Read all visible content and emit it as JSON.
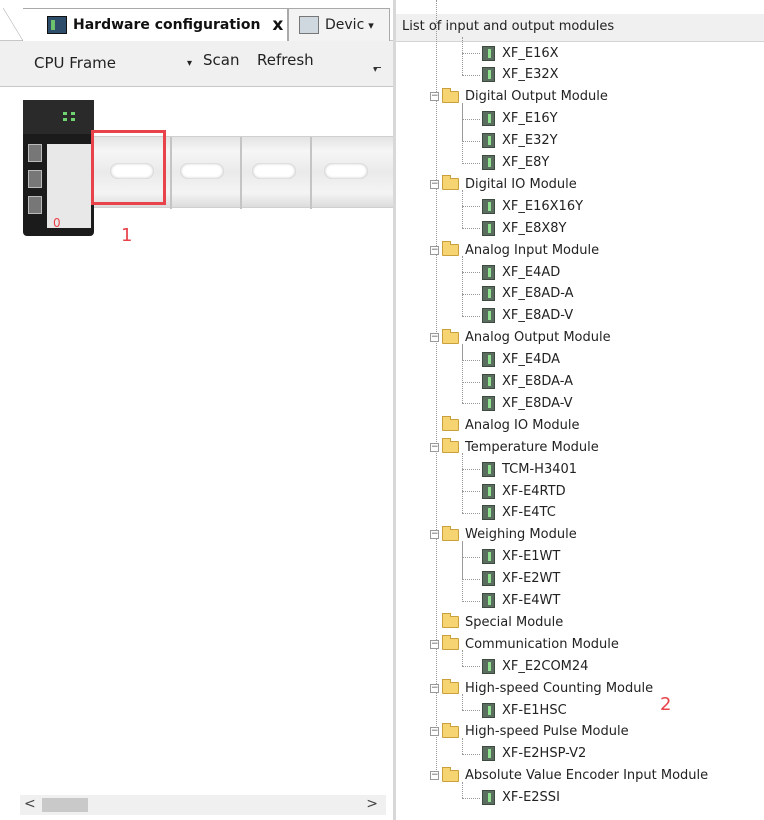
{
  "tabs": {
    "hardware": "Hardware configuration",
    "hardware_close": "x",
    "device": "Devic",
    "device_dropdown": "▾"
  },
  "toolbar": {
    "frame_select": "CPU Frame",
    "frame_arrow": "▾",
    "scan": "Scan",
    "refresh": "Refresh"
  },
  "canvas": {
    "cpu_index": "0",
    "slot_marker": "1"
  },
  "scrollbar": {
    "left": "<",
    "right": ">"
  },
  "right_panel": {
    "title": "List of input and output modules",
    "marker": "2"
  },
  "tree": [
    {
      "type": "module",
      "label": "XF_E16X"
    },
    {
      "type": "module",
      "label": "XF_E32X"
    },
    {
      "type": "folder",
      "label": "Digital Output Module",
      "expand": "−"
    },
    {
      "type": "module",
      "label": "XF_E16Y"
    },
    {
      "type": "module",
      "label": "XF_E32Y"
    },
    {
      "type": "module",
      "label": "XF_E8Y"
    },
    {
      "type": "folder",
      "label": "Digital IO Module",
      "expand": "−"
    },
    {
      "type": "module",
      "label": "XF_E16X16Y"
    },
    {
      "type": "module",
      "label": "XF_E8X8Y"
    },
    {
      "type": "folder",
      "label": "Analog Input Module",
      "expand": "−"
    },
    {
      "type": "module",
      "label": "XF_E4AD"
    },
    {
      "type": "module",
      "label": "XF_E8AD-A"
    },
    {
      "type": "module",
      "label": "XF_E8AD-V"
    },
    {
      "type": "folder",
      "label": "Analog Output Module",
      "expand": "−"
    },
    {
      "type": "module",
      "label": "XF_E4DA"
    },
    {
      "type": "module",
      "label": "XF_E8DA-A"
    },
    {
      "type": "module",
      "label": "XF_E8DA-V"
    },
    {
      "type": "folder",
      "label": "Analog IO Module",
      "expand": ""
    },
    {
      "type": "folder",
      "label": "Temperature Module",
      "expand": "−"
    },
    {
      "type": "module",
      "label": "TCM-H3401"
    },
    {
      "type": "module",
      "label": "XF-E4RTD"
    },
    {
      "type": "module",
      "label": "XF-E4TC"
    },
    {
      "type": "folder",
      "label": "Weighing Module",
      "expand": "−"
    },
    {
      "type": "module",
      "label": "XF-E1WT"
    },
    {
      "type": "module",
      "label": "XF-E2WT"
    },
    {
      "type": "module",
      "label": "XF-E4WT"
    },
    {
      "type": "folder",
      "label": "Special Module",
      "expand": ""
    },
    {
      "type": "folder",
      "label": "Communication Module",
      "expand": "−"
    },
    {
      "type": "module",
      "label": "XF_E2COM24"
    },
    {
      "type": "folder",
      "label": "High-speed Counting Module",
      "expand": "−"
    },
    {
      "type": "module",
      "label": "XF-E1HSC"
    },
    {
      "type": "folder",
      "label": "High-speed Pulse Module",
      "expand": "−"
    },
    {
      "type": "module",
      "label": "XF-E2HSP-V2"
    },
    {
      "type": "folder",
      "label": "Absolute Value Encoder Input Module",
      "expand": "−"
    },
    {
      "type": "module",
      "label": "XF-E2SSI"
    }
  ]
}
